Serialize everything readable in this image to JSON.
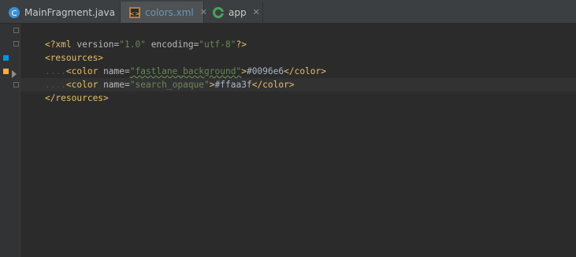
{
  "tabs": [
    {
      "label": "MainFragment.java",
      "icon": "java-class-icon",
      "active": false
    },
    {
      "label": "colors.xml",
      "icon": "xml-values-icon",
      "active": true
    },
    {
      "label": "app",
      "icon": "gradle-module-icon",
      "active": false
    }
  ],
  "close_glyph": "✕",
  "code": {
    "line1": {
      "open": "<?xml ",
      "a1": "version=",
      "v1": "\"1.0\"",
      "a2": " encoding=",
      "v2": "\"utf-8\"",
      "close": "?>"
    },
    "line2": {
      "tag": "<resources>"
    },
    "line3": {
      "indent": "....",
      "open": "<color ",
      "attr": "name=",
      "val": "\"fastlane_background\"",
      "tagclose": ">",
      "text": "#0096e6",
      "end": "</color>"
    },
    "line4": {
      "indent": "....",
      "open": "<color ",
      "attr": "name=",
      "val": "\"search_opaque\"",
      "tagclose": ">",
      "text": "#ffaa3f",
      "end": "</color>"
    },
    "line5": {
      "tag": "</resources>"
    }
  },
  "colors": {
    "swatch_1": "#0096e6",
    "swatch_2": "#ffaa3f",
    "tag": "#e8bf6a",
    "string": "#6a8759"
  }
}
